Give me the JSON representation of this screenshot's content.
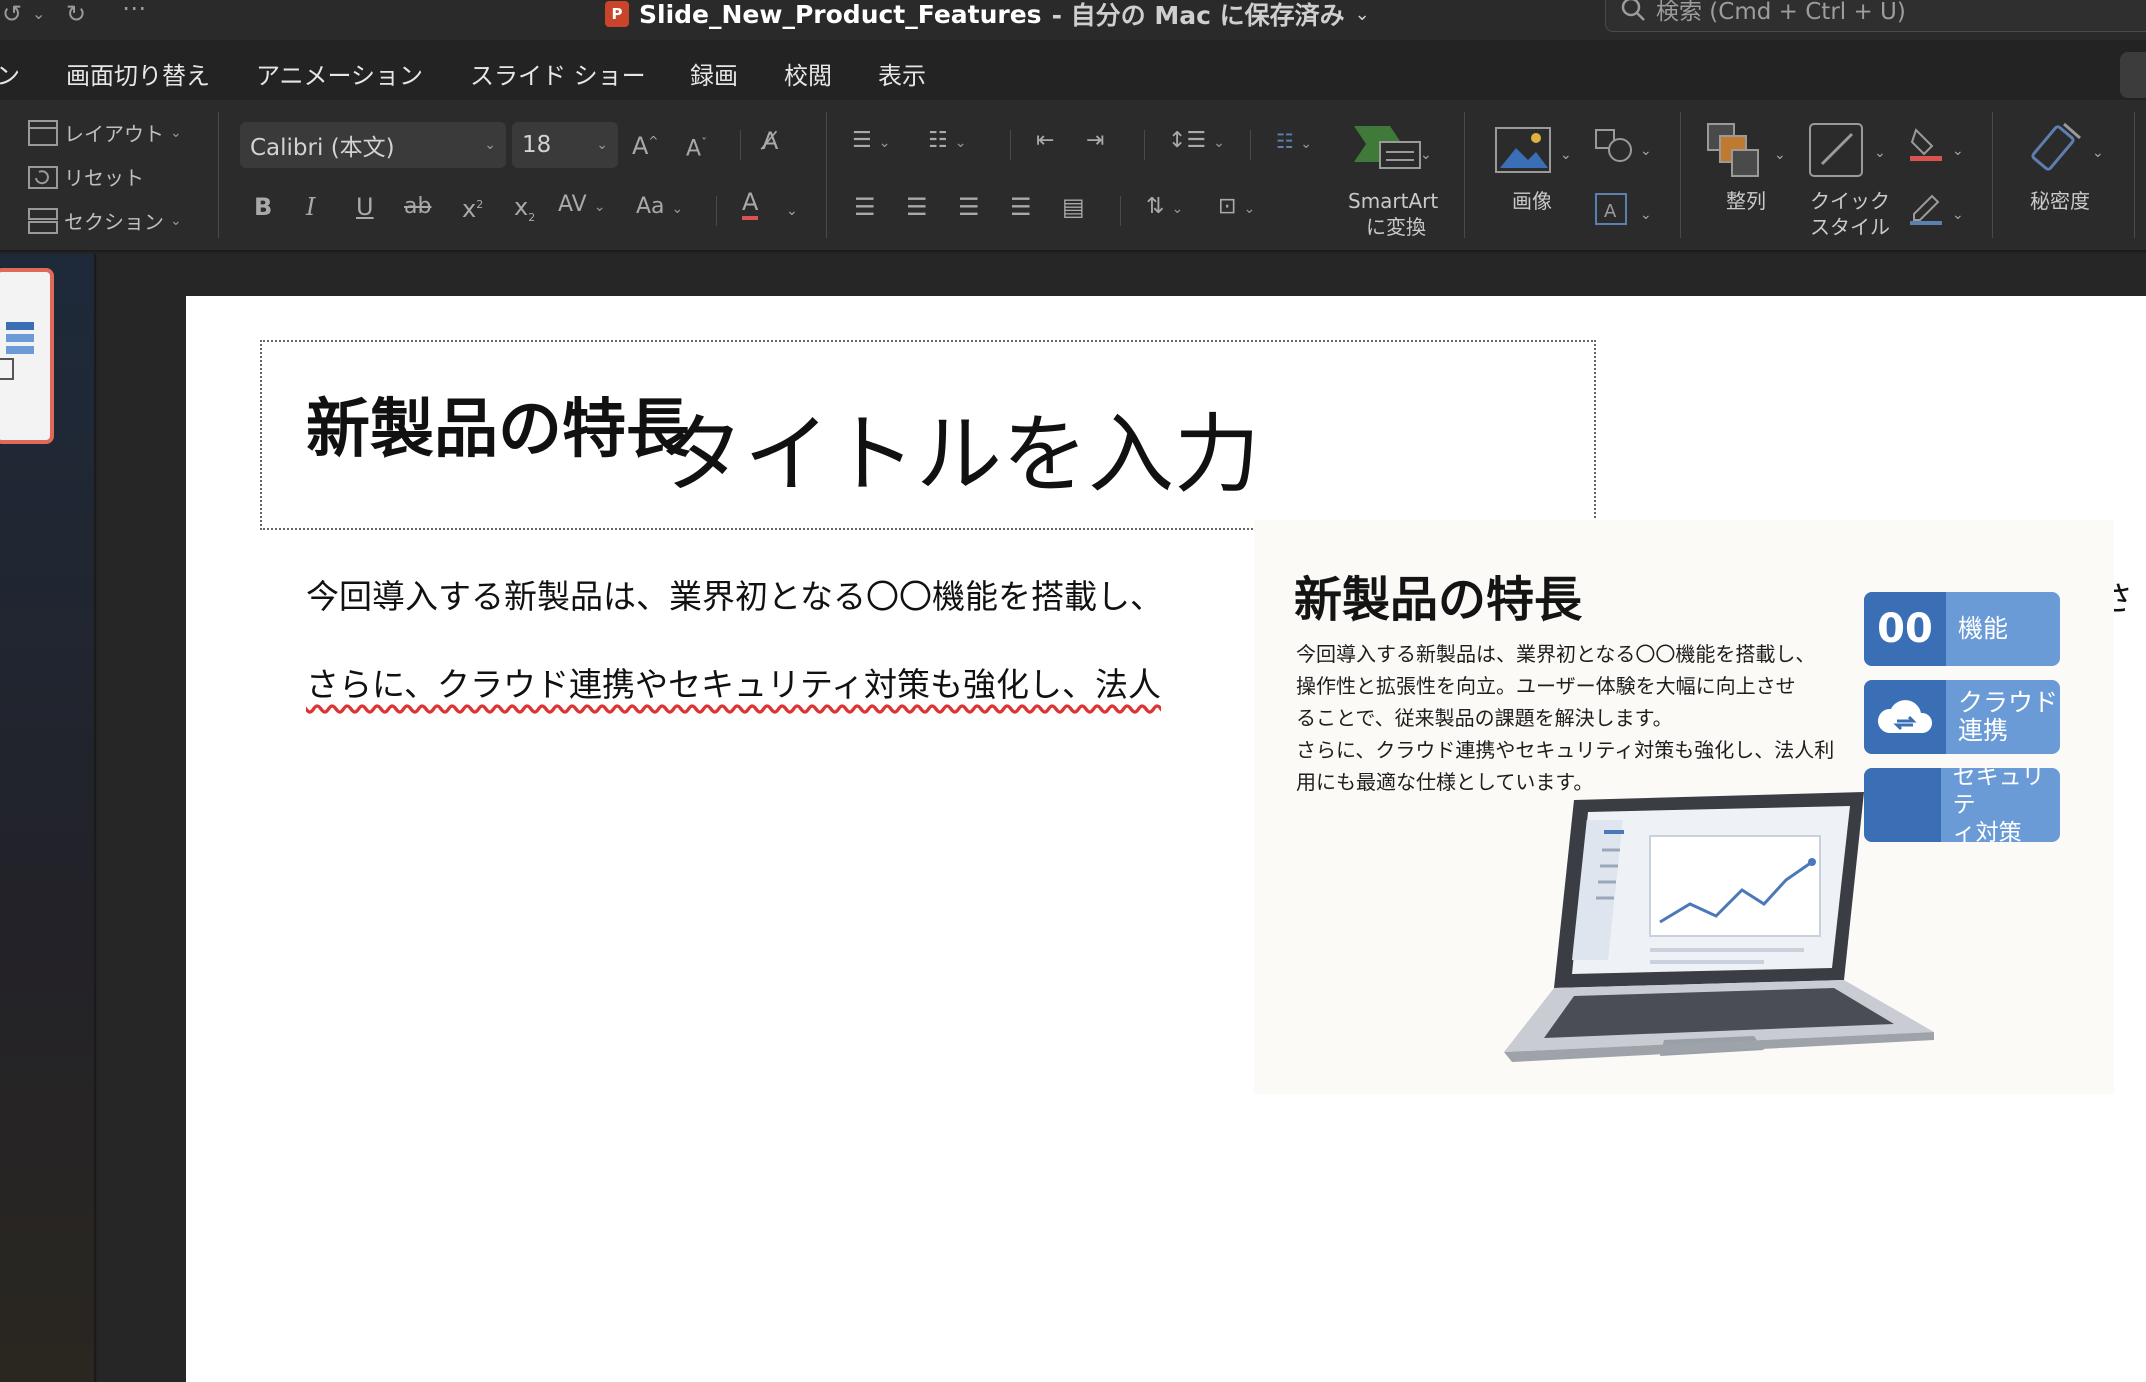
{
  "titlebar": {
    "document_name": "Slide_New_Product_Features",
    "save_status": " - 自分の Mac に保存済み",
    "search_placeholder": "検索 (Cmd + Ctrl + U)"
  },
  "menu_tabs": [
    "ン",
    "画面切り替え",
    "アニメーション",
    "スライド ショー",
    "録画",
    "校閲",
    "表示"
  ],
  "ribbon": {
    "slides_group": {
      "layout": "レイアウト",
      "reset": "リセット",
      "section": "セクション"
    },
    "font_name": "Calibri (本文)",
    "font_size": "18",
    "smartart_line1": "SmartArt",
    "smartart_line2": "に変換",
    "picture": "画像",
    "arrange": "整列",
    "quick_style_line1": "クイック",
    "quick_style_line2": "スタイル",
    "sensitivity": "秘密度"
  },
  "slide": {
    "title": "新製品の特長",
    "title_placeholder": "タイトルを入力",
    "body_line1": "今回導入する新製品は、業界初となる〇〇機能を搭載し、",
    "body_line2": "さらに、クラウド連携やセキュリティ対策も強化し、法人",
    "right_edge_clip": "さ"
  },
  "inserted_image": {
    "title": "新製品の特長",
    "lines": [
      "今回導入する新製品は、業界初となる〇〇機能を搭載し、",
      "操作性と拡張性を向立。ユーザー体験を大幅に向上させ",
      "ることで、従来製品の課題を解決します。",
      "さらに、クラウド連携やセキュリティ対策も強化し、法人利",
      "用にも最適な仕様としています。"
    ],
    "features": [
      {
        "icon_text": "00",
        "label_line1": "機能",
        "label_line2": ""
      },
      {
        "icon_text": "",
        "label_line1": "クラウド",
        "label_line2": "連携"
      },
      {
        "icon_text": "",
        "label_line1": "セキュリテ",
        "label_line2": "ィ対策"
      }
    ]
  },
  "colors": {
    "accent_thumb_border": "#e06a5a",
    "feature_badge": "#6a9bd6",
    "feature_icon": "#3b6fb5"
  }
}
